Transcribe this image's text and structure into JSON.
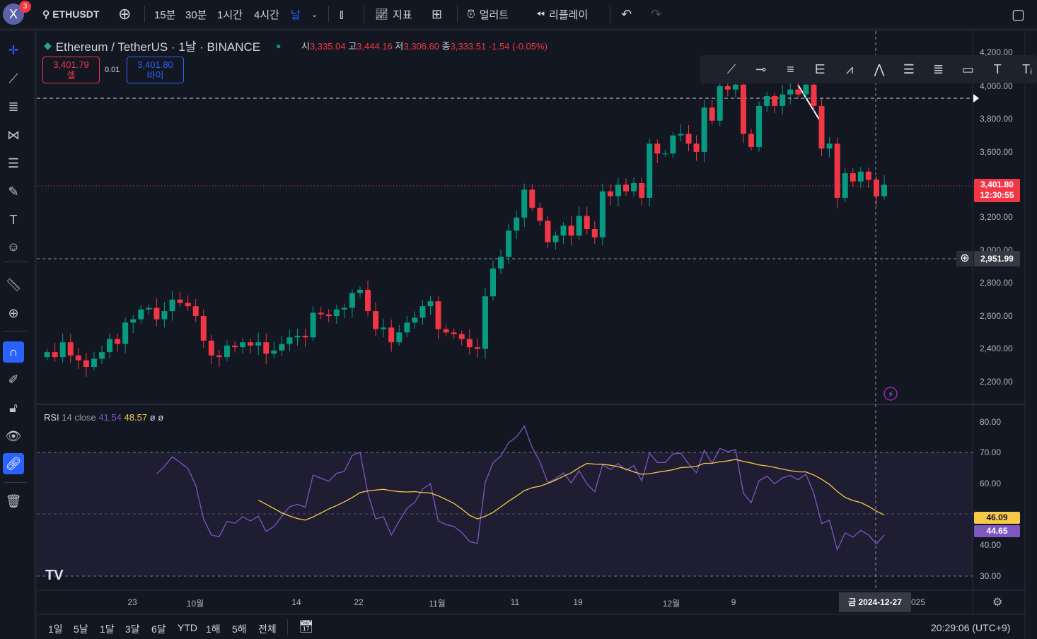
{
  "topbar": {
    "avatar": "X",
    "notif": "3",
    "symbol": "ETHUSDT",
    "intervals": [
      "15분",
      "30분",
      "1시간",
      "4시간",
      "날"
    ],
    "indicators": "지표",
    "alert": "얼러트",
    "replay": "리플레이"
  },
  "legend": {
    "title": "Ethereum / TetherUS · 1날 · BINANCE",
    "o_label": "시",
    "o": "3,335.04",
    "h_label": "고",
    "h": "3,444.16",
    "l_label": "저",
    "l": "3,306.60",
    "c_label": "종",
    "c": "3,333.51",
    "chg": "-1.54 (-0.05%)"
  },
  "trade": {
    "sell_price": "3,401.79",
    "sell_label": "셀",
    "spread": "0.01",
    "buy_price": "3,401.80",
    "buy_label": "바이"
  },
  "price_scale": [
    "4,200.00",
    "4,000.00",
    "3,800.00",
    "3,600.00",
    "3,200.00",
    "3,000.00",
    "2,800.00",
    "2,600.00",
    "2,400.00",
    "2,200.00"
  ],
  "last_price": "3,401.80",
  "countdown": "12:30:55",
  "crosshair_price": "2,951.99",
  "rsi": {
    "name": "RSI",
    "params": "14 close",
    "v1": "41.54",
    "v2": "48.57",
    "e1": "ø",
    "e2": "ø",
    "scale": [
      "80.00",
      "70.00",
      "60.00",
      "40.00",
      "30.00"
    ],
    "tag1": "46.09",
    "tag2": "44.65"
  },
  "xaxis": [
    "23",
    "10월",
    "14",
    "22",
    "11월",
    "11",
    "19",
    "12월",
    "9",
    "025"
  ],
  "crosshair_date": "금 2024-12-27",
  "ranges": [
    "1일",
    "5날",
    "1달",
    "3달",
    "6달",
    "YTD",
    "1해",
    "5해",
    "전체"
  ],
  "clock": "20:29:06 (UTC+9)",
  "colors": {
    "up": "#089981",
    "down": "#f23645",
    "rsi": "#7e57c2",
    "ma": "#f7c948"
  },
  "chart_data": {
    "type": "candlestick",
    "ylim": [
      2100,
      4220
    ],
    "closes": [
      2380,
      2350,
      2440,
      2360,
      2330,
      2290,
      2340,
      2380,
      2460,
      2430,
      2560,
      2580,
      2640,
      2650,
      2580,
      2630,
      2700,
      2680,
      2660,
      2600,
      2450,
      2360,
      2350,
      2420,
      2410,
      2440,
      2420,
      2440,
      2370,
      2390,
      2430,
      2470,
      2480,
      2470,
      2620,
      2610,
      2600,
      2640,
      2650,
      2740,
      2760,
      2630,
      2520,
      2530,
      2440,
      2500,
      2560,
      2590,
      2660,
      2690,
      2520,
      2500,
      2490,
      2460,
      2410,
      2400,
      2720,
      2890,
      2960,
      3120,
      3200,
      3370,
      3260,
      3180,
      3050,
      3090,
      3150,
      3090,
      3210,
      3130,
      3080,
      3360,
      3330,
      3400,
      3360,
      3410,
      3320,
      3650,
      3590,
      3590,
      3700,
      3710,
      3650,
      3600,
      3870,
      3790,
      4000,
      3980,
      4010,
      3710,
      3630,
      3880,
      3940,
      3880,
      3950,
      3980,
      3950,
      4010,
      3880,
      3620,
      3650,
      3320,
      3470,
      3420,
      3480,
      3430,
      3330,
      3400
    ]
  }
}
